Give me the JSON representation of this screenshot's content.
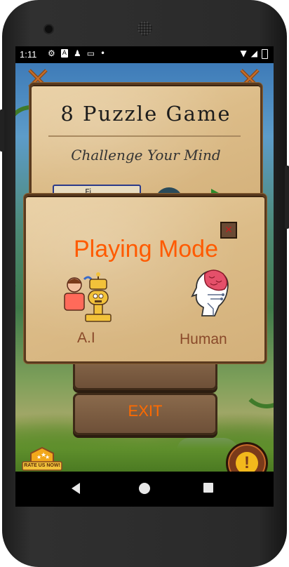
{
  "status_bar": {
    "time": "1:11",
    "icons": [
      "settings-icon",
      "a-icon",
      "figure-icon",
      "cast-icon",
      "dot-icon"
    ],
    "right_icons": [
      "wifi-icon",
      "signal-icon",
      "battery-charging-icon"
    ]
  },
  "game": {
    "title": "8 Puzzle Game",
    "subtitle": "Challenge Your Mind",
    "hidden_button_fragment": "Fi"
  },
  "dialog": {
    "title": "Playing Mode",
    "options": [
      {
        "label": "A.I",
        "icon": "human-and-robot-icon"
      },
      {
        "label": "Human",
        "icon": "robotic-brain-head-icon"
      }
    ],
    "close_icon": "close-icon"
  },
  "buttons": {
    "exit_label": "EXIT"
  },
  "badge": {
    "rate_label": "RATE US NOW!"
  },
  "colors": {
    "accent_orange": "#ff5a00",
    "mode_label": "#8a4a2a",
    "parchment": "#dcbc88",
    "wood": "#6e5038"
  },
  "navbar": {
    "icons": [
      "back-icon",
      "home-icon",
      "recents-icon"
    ]
  }
}
